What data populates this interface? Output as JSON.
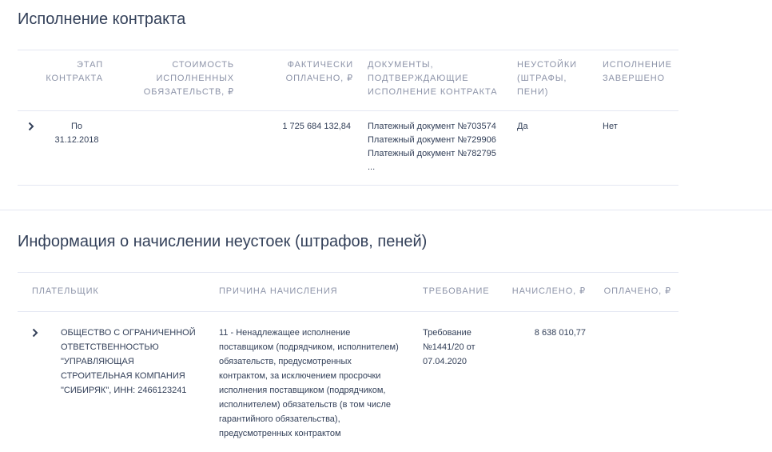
{
  "contract_execution": {
    "title": "Исполнение контракта",
    "columns": {
      "stage": "ЭТАП\nКОНТРАКТА",
      "cost": "СТОИМОСТЬ\nИСПОЛНЕННЫХ\nОБЯЗАТЕЛЬСТВ, ₽",
      "paid": "ФАКТИЧЕСКИ\nОПЛАЧЕНО, ₽",
      "docs": "ДОКУМЕНТЫ,\nПОДТВЕРЖДАЮЩИЕ\nИСПОЛНЕНИЕ КОНТРАКТА",
      "penalties": "НЕУСТОЙКИ\n(ШТРАФЫ,\nПЕНИ)",
      "completed": "ИСПОЛНЕНИЕ\nЗАВЕРШЕНО"
    },
    "row": {
      "stage": "По\n31.12.2018",
      "cost": "",
      "paid": "1 725 684 132,84",
      "docs": "Платежный документ №703574\nПлатежный документ №729906\nПлатежный документ №782795\n...",
      "penalties": "Да",
      "completed": "Нет"
    }
  },
  "penalties_info": {
    "title": "Информация о начислении неустоек (штрафов, пеней)",
    "columns": {
      "payer": "ПЛАТЕЛЬЩИК",
      "reason": "ПРИЧИНА НАЧИСЛЕНИЯ",
      "demand": "ТРЕБОВАНИЕ",
      "accrued": "НАЧИСЛЕНО, ₽",
      "paid": "ОПЛАЧЕНО, ₽"
    },
    "row": {
      "payer": "ОБЩЕСТВО С ОГРАНИЧЕННОЙ\nОТВЕТСТВЕННОСТЬЮ\n\"УПРАВЛЯЮЩАЯ\nСТРОИТЕЛЬНАЯ КОМПАНИЯ\n\"СИБИРЯК\", ИНН: 2466123241",
      "reason": "11 - Ненадлежащее исполнение\nпоставщиком (подрядчиком, исполнителем)\nобязательств, предусмотренных\nконтрактом, за исключением просрочки\nисполнения поставщиком (подрядчиком,\nисполнителем) обязательств (в том числе\nгарантийного обязательства),\nпредусмотренных контрактом",
      "demand": "Требование\n№1441/20 от\n07.04.2020",
      "accrued": "8 638 010,77",
      "paid": ""
    }
  }
}
